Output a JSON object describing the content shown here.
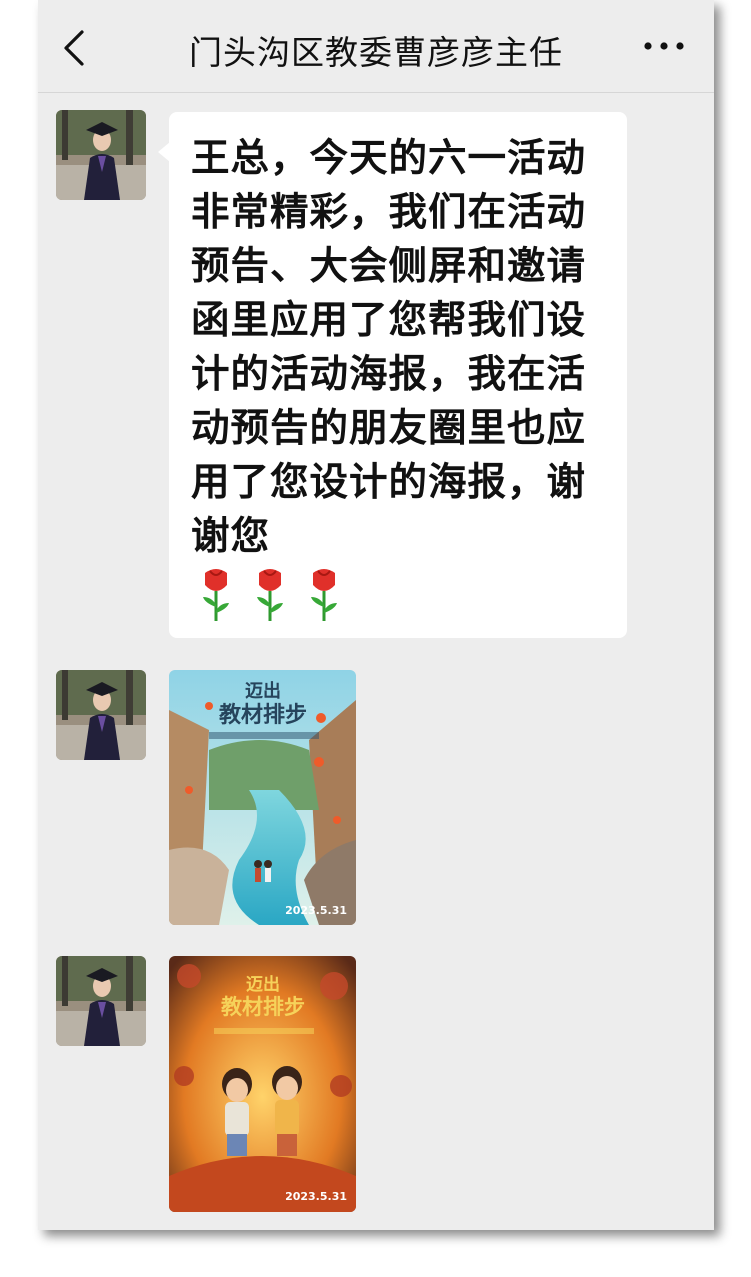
{
  "header": {
    "title": "门头沟区教委曹彦彦主任"
  },
  "messages": [
    {
      "type": "text",
      "text": "王总，今天的六一活动非常精彩，我们在活动预告、大会侧屏和邀请函里应用了您帮我们设计的活动海报，我在活动预告的朋友圈里也应用了您设计的海报，谢谢您",
      "emoji": [
        "rose-emoji",
        "rose-emoji",
        "rose-emoji"
      ]
    },
    {
      "type": "image",
      "poster": {
        "title_line1": "迈出",
        "title_line2": "教材排步",
        "date": "2023.5.31"
      }
    },
    {
      "type": "image",
      "poster": {
        "title_line1": "迈出",
        "title_line2": "教材排步",
        "date": "2023.5.31"
      }
    }
  ],
  "icons": {
    "back": "chevron-left-icon",
    "more": "more-dots-icon"
  },
  "colors": {
    "chat_background": "#ededed",
    "bubble": "#ffffff",
    "text": "#111111"
  }
}
